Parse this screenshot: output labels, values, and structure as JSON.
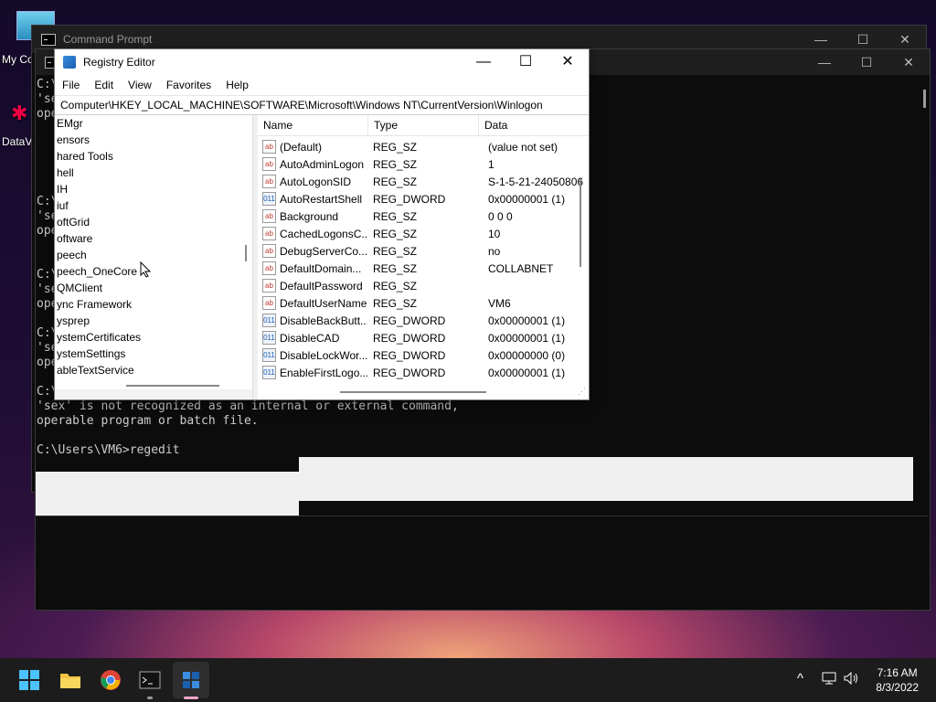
{
  "desktop": {
    "icons": [
      {
        "label": "My Co",
        "icon": "computer-icon"
      },
      {
        "label": "DataV",
        "icon": "app-shortcut-icon"
      }
    ]
  },
  "cmd_back": {
    "title": "Command Prompt"
  },
  "console": {
    "left_fragments": [
      "C:\\",
      "'se",
      "ope",
      "C:\\",
      "'se",
      "ope",
      "C:\\",
      "'se",
      "ope",
      "C:\\",
      "'se",
      "ope",
      "C:\\"
    ],
    "line_error": "'sex' is not recognized as an internal or external command,",
    "line_operable": "operable program or batch file.",
    "line_prompt": "C:\\Users\\VM6>regedit"
  },
  "regedit": {
    "title": "Registry Editor",
    "menu": [
      "File",
      "Edit",
      "View",
      "Favorites",
      "Help"
    ],
    "address": "Computer\\HKEY_LOCAL_MACHINE\\SOFTWARE\\Microsoft\\Windows NT\\CurrentVersion\\Winlogon",
    "tree": [
      "EMgr",
      "ensors",
      "hared Tools",
      "hell",
      "IH",
      "iuf",
      "oftGrid",
      "oftware",
      "peech",
      "peech_OneCore",
      "QMClient",
      "ync Framework",
      "ysprep",
      "ystemCertificates",
      "ystemSettings",
      "ableTextService"
    ],
    "columns": [
      "Name",
      "Type",
      "Data"
    ],
    "values": [
      {
        "name": "(Default)",
        "type": "REG_SZ",
        "data": "(value not set)",
        "kind": "sz"
      },
      {
        "name": "AutoAdminLogon",
        "type": "REG_SZ",
        "data": "1",
        "kind": "sz"
      },
      {
        "name": "AutoLogonSID",
        "type": "REG_SZ",
        "data": "S-1-5-21-24050806",
        "kind": "sz"
      },
      {
        "name": "AutoRestartShell",
        "type": "REG_DWORD",
        "data": "0x00000001 (1)",
        "kind": "dw"
      },
      {
        "name": "Background",
        "type": "REG_SZ",
        "data": "0 0 0",
        "kind": "sz"
      },
      {
        "name": "CachedLogonsC...",
        "type": "REG_SZ",
        "data": "10",
        "kind": "sz"
      },
      {
        "name": "DebugServerCo...",
        "type": "REG_SZ",
        "data": "no",
        "kind": "sz"
      },
      {
        "name": "DefaultDomain...",
        "type": "REG_SZ",
        "data": "COLLABNET",
        "kind": "sz"
      },
      {
        "name": "DefaultPassword",
        "type": "REG_SZ",
        "data": "",
        "kind": "sz"
      },
      {
        "name": "DefaultUserName",
        "type": "REG_SZ",
        "data": "VM6",
        "kind": "sz"
      },
      {
        "name": "DisableBackButt...",
        "type": "REG_DWORD",
        "data": "0x00000001 (1)",
        "kind": "dw"
      },
      {
        "name": "DisableCAD",
        "type": "REG_DWORD",
        "data": "0x00000001 (1)",
        "kind": "dw"
      },
      {
        "name": "DisableLockWor...",
        "type": "REG_DWORD",
        "data": "0x00000000 (0)",
        "kind": "dw"
      },
      {
        "name": "EnableFirstLogo...",
        "type": "REG_DWORD",
        "data": "0x00000001 (1)",
        "kind": "dw"
      }
    ],
    "value_icon_text": {
      "sz": "ab",
      "dw": "011"
    }
  },
  "taskbar": {
    "apps": [
      "windows-start-icon",
      "file-explorer-icon",
      "chrome-icon",
      "command-prompt-icon",
      "registry-editor-icon"
    ],
    "time": "7:16 AM",
    "date": "8/3/2022"
  }
}
